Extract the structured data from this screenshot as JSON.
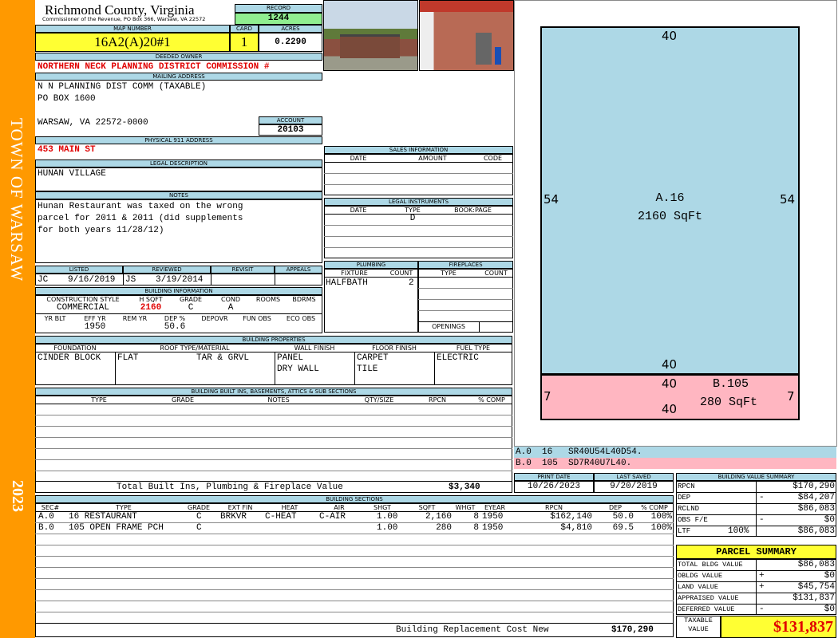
{
  "sidebar": {
    "town": "TOWN OF WARSAW",
    "year": "2023"
  },
  "header": {
    "county": "Richmond County, Virginia",
    "commissioner": "Commissioner of the Revenue, PO Box 366, Warsaw, VA 22572",
    "record_label": "RECORD",
    "record": "1244",
    "map_label": "MAP NUMBER",
    "map": "16A2(A)20#1",
    "card_label": "CARD",
    "card": "1",
    "acres_label": "ACRES",
    "acres": "0.2290"
  },
  "owner": {
    "deeded_label": "DEEDED OWNER",
    "deeded": "NORTHERN NECK PLANNING DISTRICT COMMISSION #",
    "mailing_label": "MAILING ADDRESS",
    "line1": "N N PLANNING DIST COMM (TAXABLE)",
    "line2": "PO BOX 1600",
    "line3": "WARSAW, VA 22572-0000",
    "account_label": "ACCOUNT",
    "account": "20103",
    "physical_label": "PHYSICAL 911 ADDRESS",
    "physical": "453 MAIN ST"
  },
  "legal": {
    "label": "LEGAL DESCRIPTION",
    "text": "HUNAN VILLAGE"
  },
  "notes": {
    "label": "NOTES",
    "line1": "Hunan Restaurant was taxed on the wrong",
    "line2": "parcel for 2011 & 2011 (did supplements",
    "line3": "for both years 11/28/12)"
  },
  "review": {
    "listed_label": "LISTED",
    "reviewed_label": "REVIEWED",
    "revisit_label": "REVISIT",
    "appeals_label": "APPEALS",
    "listed_by": "JC",
    "listed_date": "9/16/2019",
    "reviewed_by": "JS",
    "reviewed_date": "3/19/2014"
  },
  "building_info": {
    "label": "BUILDING INFORMATION",
    "h": [
      "CONSTRUCTION STYLE",
      "H SQFT",
      "GRADE",
      "COND",
      "ROOMS",
      "BDRMS"
    ],
    "style": "COMMERCIAL",
    "hsqft": "2160",
    "grade": "C",
    "cond": "A",
    "h2": [
      "YR BLT",
      "EFF YR",
      "REM YR",
      "DEP %",
      "DEPOVR",
      "FUN OBS",
      "ECO OBS"
    ],
    "eff_yr": "1950",
    "dep": "50.6"
  },
  "sales": {
    "label": "SALES INFORMATION",
    "h": [
      "DATE",
      "AMOUNT",
      "CODE"
    ]
  },
  "instruments": {
    "label": "LEGAL INSTRUMENTS",
    "h": [
      "DATE",
      "TYPE",
      "BOOK:PAGE"
    ],
    "type1": "D"
  },
  "plumbing": {
    "label": "PLUMBING",
    "h": [
      "FIXTURE",
      "COUNT"
    ],
    "fixture": "HALFBATH",
    "count": "2"
  },
  "fireplaces": {
    "label": "FIREPLACES",
    "h": [
      "TYPE",
      "COUNT"
    ],
    "openings": "OPENINGS"
  },
  "properties": {
    "label": "BUILDING PROPERTIES",
    "h": [
      "FOUNDATION",
      "ROOF TYPE/MATERIAL",
      "WALL FINISH",
      "FLOOR FINISH",
      "FUEL TYPE"
    ],
    "foundation": "CINDER BLOCK",
    "roof_type": "FLAT",
    "roof_mat": "TAR & GRVL",
    "wall1": "PANEL",
    "wall2": "DRY WALL",
    "floor1": "CARPET",
    "floor2": "TILE",
    "fuel": "ELECTRIC"
  },
  "builtins": {
    "label": "BUILDING BUILT INS, BASEMENTS, ATTICS & SUB SECTIONS",
    "h": [
      "TYPE",
      "GRADE",
      "NOTES",
      "QTY/SIZE",
      "RPCN",
      "% COMP"
    ],
    "total_label": "Total Built Ins, Plumbing & Fireplace Value",
    "total": "$3,340"
  },
  "dates": {
    "print_label": "PRINT DATE",
    "print": "10/26/2023",
    "saved_label": "LAST SAVED",
    "saved": "9/20/2019"
  },
  "sections": {
    "label": "BUILDING SECTIONS",
    "h": [
      "SEC#",
      "TYPE",
      "GRADE",
      "EXT FIN",
      "HEAT",
      "AIR",
      "SHGT",
      "SQFT",
      "WHGT",
      "EYEAR",
      "RPCN",
      "DEP",
      "% COMP"
    ],
    "rows": [
      [
        "A.0",
        "16 RESTAURANT",
        "C",
        "BRKVR",
        "C-HEAT",
        "C-AIR",
        "1.00",
        "2,160",
        "8",
        "1950",
        "$162,140",
        "50.0",
        "100%"
      ],
      [
        "B.0",
        "105 OPEN FRAME PCH",
        "C",
        "",
        "",
        "",
        "1.00",
        "280",
        "8",
        "1950",
        "$4,810",
        "69.5",
        "100%"
      ]
    ],
    "rcn_label": "Building Replacement Cost New",
    "rcn": "$170,290"
  },
  "sketch": {
    "a_top": "40",
    "a_left": "54",
    "a_right": "54",
    "a_bottom": "40",
    "a_name": "A.16",
    "a_area": "2160 SqFt",
    "b_top": "40",
    "b_left": "7",
    "b_right": "7",
    "b_bottom": "40",
    "b_name": "B.105",
    "b_area": "280 SqFt",
    "legend1": "A.0  16   SR40U54L40D54.",
    "legend2": "B.0  105  SD7R40U7L40."
  },
  "bvs": {
    "label": "BUILDING VALUE SUMMARY",
    "rpcn_label": "RPCN",
    "rpcn": "$170,290",
    "dep_label": "DEP",
    "dep_sign": "-",
    "dep": "$84,207",
    "rclnd_label": "RCLND",
    "rclnd": "$86,083",
    "obs_label": "OBS F/E",
    "obs_sign": "-",
    "obs": "$0",
    "ltf_label": "LTF",
    "ltf_pct": "100%",
    "ltf": "$86,083"
  },
  "parcel": {
    "label": "PARCEL SUMMARY",
    "bldg_label": "TOTAL BLDG VALUE",
    "bldg": "$86,083",
    "obldg_label": "OBLDG VALUE",
    "obldg_sign": "+",
    "obldg": "$0",
    "land_label": "LAND VALUE",
    "land_sign": "+",
    "land": "$45,754",
    "appraised_label": "APPRAISED VALUE",
    "appraised": "$131,837",
    "deferred_label": "DEFERRED VALUE",
    "deferred_sign": "-",
    "deferred": "$0",
    "taxable_label1": "TAXABLE",
    "taxable_label2": "VALUE",
    "taxable": "$131,837"
  }
}
